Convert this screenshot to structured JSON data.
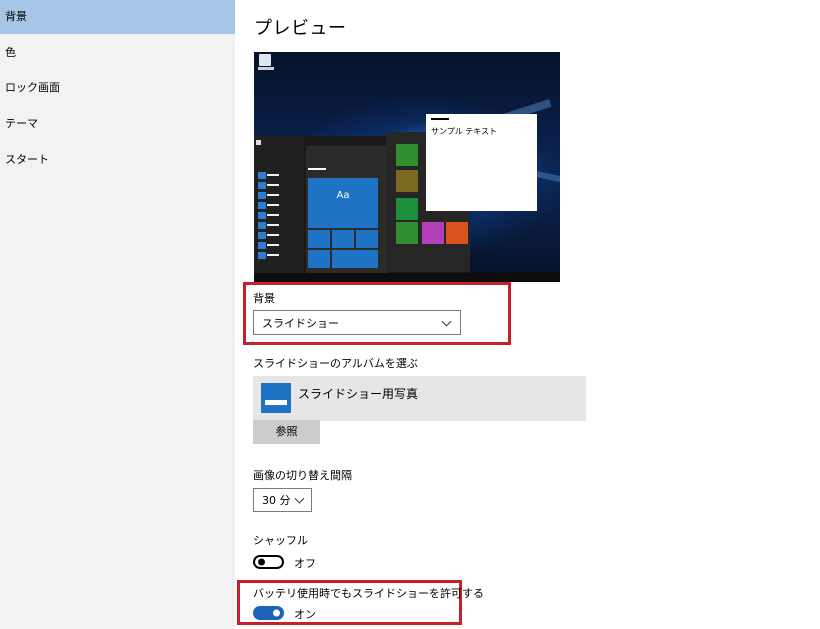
{
  "sidebar": {
    "items": [
      {
        "label": "背景",
        "selected": true
      },
      {
        "label": "色"
      },
      {
        "label": "ロック画面"
      },
      {
        "label": "テーマ"
      },
      {
        "label": "スタート"
      }
    ]
  },
  "main": {
    "title": "プレビュー",
    "preview": {
      "sample_text": "サンプル テキスト",
      "tile_label": "Aa"
    },
    "background": {
      "label": "背景",
      "selected": "スライドショー"
    },
    "album": {
      "label": "スライドショーのアルバムを選ぶ",
      "name": "スライドショー用写真",
      "browse_label": "参照"
    },
    "interval": {
      "label": "画像の切り替え間隔",
      "selected": "30 分"
    },
    "shuffle": {
      "label": "シャッフル",
      "state_text": "オフ",
      "on": false
    },
    "battery": {
      "label": "バッテリ使用時でもスライドショーを許可する",
      "state_text": "オン",
      "on": true
    }
  },
  "colors": {
    "accent": "#1f63b8",
    "selected_nav": "#a5c6e6",
    "highlight_box": "#c8202a"
  }
}
